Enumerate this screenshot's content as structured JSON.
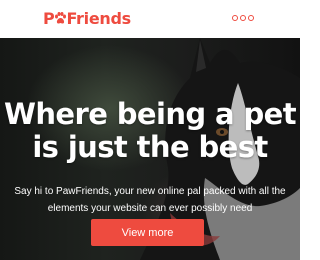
{
  "brand": {
    "name_prefix": "P",
    "name_suffix": "Friends",
    "accent_color": "#ee4b3f",
    "logo_icon": "paw-icon"
  },
  "nav": {
    "menu_icon": "three-dots-menu-icon"
  },
  "hero": {
    "title": "Where being a pet is just the best",
    "subtitle": "Say hi to PawFriends, your new online pal packed with all the elements your website can ever possibly need",
    "cta_label": "View more",
    "image": "black-and-white-dog-photo"
  }
}
